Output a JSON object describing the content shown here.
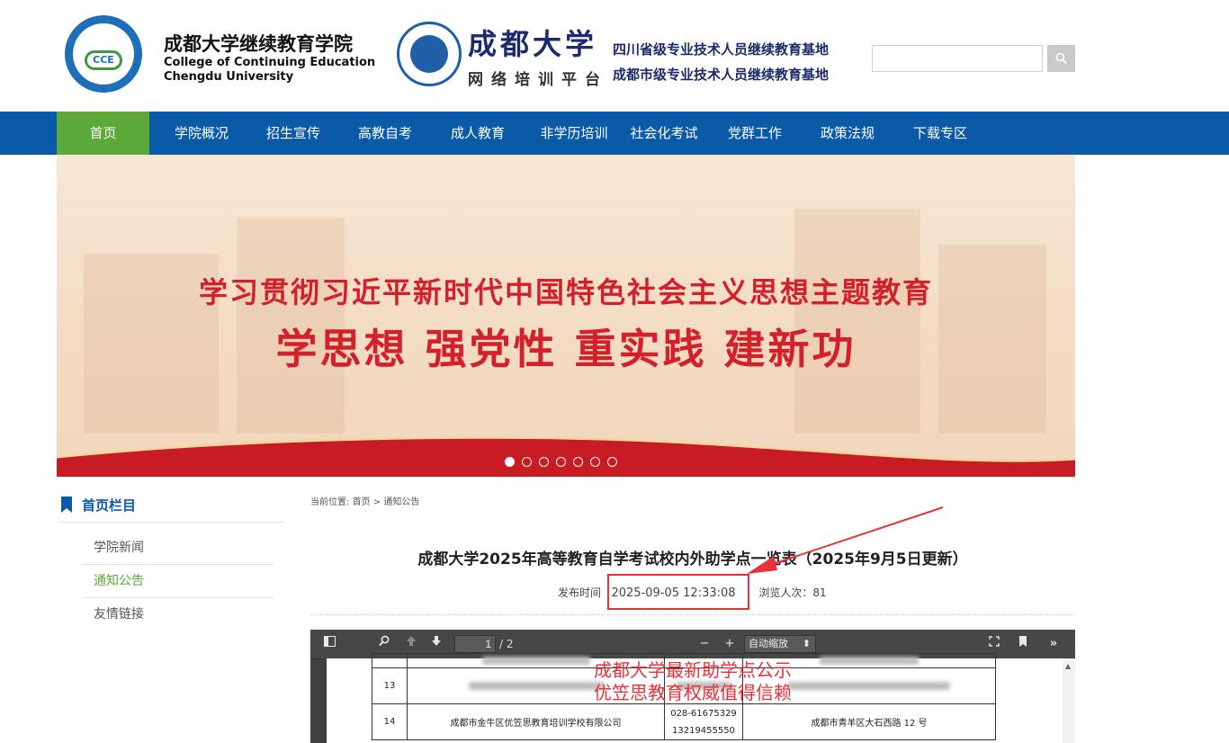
{
  "header": {
    "college_cn": "成都大学继续教育学院",
    "college_en_line1": "College of Continuing Education",
    "college_en_line2": "Chengdu University",
    "logo_text": "CCE",
    "university_name": "成都大学",
    "platform_name": "网络培训平台",
    "base_line1": "四川省级专业技术人员继续教育基地",
    "base_line2": "成都市级专业技术人员继续教育基地",
    "search_placeholder": ""
  },
  "nav": {
    "items": [
      {
        "label": "首页",
        "active": true
      },
      {
        "label": "学院概况"
      },
      {
        "label": "招生宣传"
      },
      {
        "label": "高教自考"
      },
      {
        "label": "成人教育"
      },
      {
        "label": "非学历培训"
      },
      {
        "label": "社会化考试"
      },
      {
        "label": "党群工作"
      },
      {
        "label": "政策法规"
      },
      {
        "label": "下载专区"
      }
    ]
  },
  "banner": {
    "line1": "学习贯彻习近平新时代中国特色社会主义思想主题教育",
    "line2": "学思想 强党性 重实践 建新功",
    "slide_count": 7,
    "active_slide": 1
  },
  "sidebar": {
    "title": "首页栏目",
    "items": [
      {
        "label": "学院新闻"
      },
      {
        "label": "通知公告",
        "active": true
      },
      {
        "label": "友情链接"
      }
    ]
  },
  "breadcrumb": {
    "prefix": "当前位置:",
    "home": "首页",
    "sep": ">",
    "current": "通知公告"
  },
  "article": {
    "title": "成都大学2025年高等教育自学考试校内外助学点一览表（2025年9月5日更新）",
    "publish_label": "发布时间",
    "publish_time": "2025-09-05 12:33:08",
    "views_label": "浏览人次：",
    "views": "81"
  },
  "pdf_viewer": {
    "current_page": "1",
    "total_pages": "/ 2",
    "zoom": "自动缩放",
    "zoom_out": "−",
    "zoom_in": "+",
    "rows": [
      {
        "no": "13"
      },
      {
        "no": "14",
        "name": "成都市金牛区优笠思教育培训学校有限公司",
        "phone1": "028-61675329",
        "phone2": "13219455550",
        "address": "成都市青羊区大石西路 12 号"
      }
    ]
  },
  "overlay": {
    "line1": "成都大学最新助学点公示",
    "line2": "优笠思教育权威值得信赖"
  },
  "colors": {
    "nav_bg": "#0a5aa8",
    "nav_active": "#5ca838",
    "banner_red": "#d3202a",
    "annotation_red": "#e5323b"
  }
}
